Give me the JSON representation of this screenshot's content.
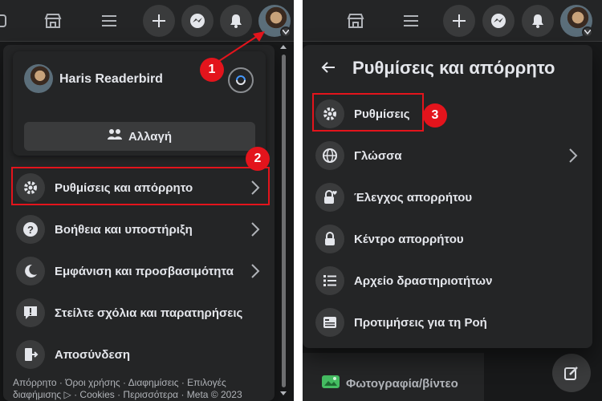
{
  "left": {
    "profile_name": "Haris Readerbird",
    "switch_label": "Αλλαγή",
    "menu": [
      {
        "label": "Ρυθμίσεις και απόρρητο",
        "icon": "gear-icon"
      },
      {
        "label": "Βοήθεια και υποστήριξη",
        "icon": "help-icon"
      },
      {
        "label": "Εμφάνιση και προσβασιμότητα",
        "icon": "moon-icon"
      },
      {
        "label": "Στείλτε σχόλια και παρατηρήσεις",
        "icon": "feedback-icon"
      },
      {
        "label": "Αποσύνδεση",
        "icon": "logout-icon"
      }
    ],
    "footer_line1": "Απόρρητο · Όροι χρήσης · Διαφημίσεις · Επιλογές",
    "footer_line2": "διαφήμισης ▷ · Cookies · Περισσότερα · Meta © 2023"
  },
  "right": {
    "header_title": "Ρυθμίσεις και απόρρητο",
    "menu": [
      {
        "label": "Ρυθμίσεις",
        "icon": "gear-icon"
      },
      {
        "label": "Γλώσσα",
        "icon": "globe-icon"
      },
      {
        "label": "Έλεγχος απορρήτου",
        "icon": "lock-heart-icon"
      },
      {
        "label": "Κέντρο απορρήτου",
        "icon": "lock-icon"
      },
      {
        "label": "Αρχείο δραστηριοτήτων",
        "icon": "list-icon"
      },
      {
        "label": "Προτιμήσεις για τη Ροή",
        "icon": "feed-icon"
      }
    ],
    "photo_video_label": "Φωτογραφία/βίντεο"
  },
  "annotations": {
    "one": "1",
    "two": "2",
    "three": "3"
  },
  "colors": {
    "accent_red": "#e3141c",
    "bg": "#18191a",
    "surface": "#242526",
    "hover": "#3a3b3c",
    "text": "#e4e6eb"
  }
}
